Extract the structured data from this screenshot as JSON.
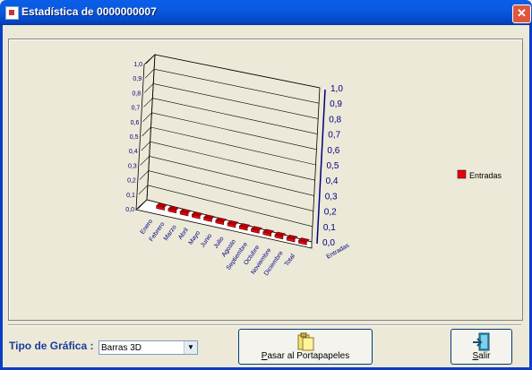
{
  "window": {
    "title": "Estadística de 0000000007",
    "close_glyph": "✕"
  },
  "chart_data": {
    "type": "bar",
    "style": "3d",
    "categories": [
      "Enero",
      "Febrero",
      "Marzo",
      "Abril",
      "Mayo",
      "Junio",
      "Julio",
      "Agosto",
      "Septiembre",
      "Octubre",
      "Noviembre",
      "Diciembre",
      "Total"
    ],
    "series": [
      {
        "name": "Entradas",
        "values": [
          0,
          0,
          0,
          0,
          0,
          0,
          0,
          0,
          0,
          0,
          0,
          0,
          0
        ],
        "color": "#e8000d"
      }
    ],
    "ylim": [
      0,
      1
    ],
    "ticks": [
      "0,0",
      "0,1",
      "0,2",
      "0,3",
      "0,4",
      "0,5",
      "0,6",
      "0,7",
      "0,8",
      "0,9",
      "1,0"
    ],
    "depth_axis_label": "Entradas",
    "legend_position": "right",
    "grid": true
  },
  "footer": {
    "chart_type_label": "Tipo de Gráfica :",
    "chart_type_value": "Barras 3D",
    "copy_button": "Pasar al Portapapeles",
    "exit_button": "Salir"
  }
}
